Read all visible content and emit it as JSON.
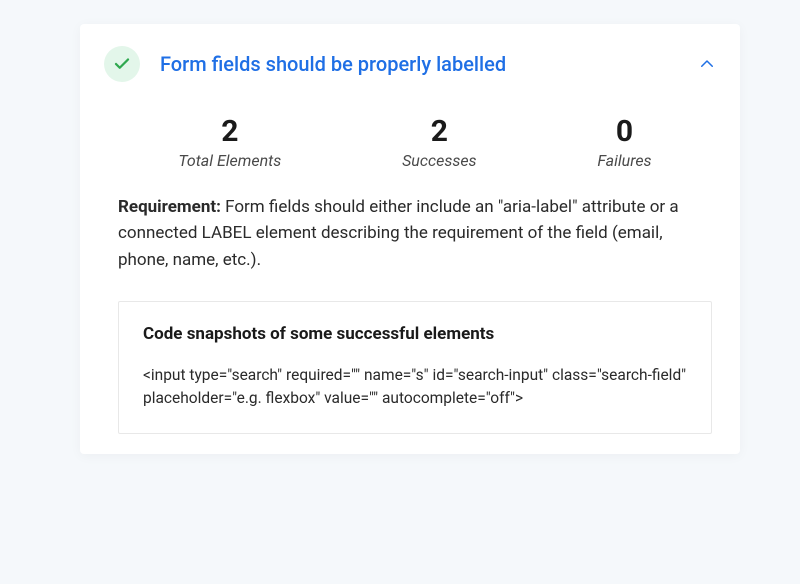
{
  "accordion": {
    "status": "success",
    "title": "Form fields should be properly labelled",
    "expanded": true
  },
  "stats": {
    "total": {
      "value": "2",
      "label": "Total Elements"
    },
    "successes": {
      "value": "2",
      "label": "Successes"
    },
    "failures": {
      "value": "0",
      "label": "Failures"
    }
  },
  "requirement": {
    "label": "Requirement:",
    "text": " Form fields should either include an \"aria-label\" attribute or a connected LABEL element describing the requirement of the field (email, phone, name, etc.)."
  },
  "snapshots": {
    "heading": "Code snapshots of some successful elements",
    "code": "<input type=\"search\" required=\"\" name=\"s\" id=\"search-input\" class=\"search-field\" placeholder=\"e.g. flexbox\" value=\"\" autocomplete=\"off\">"
  },
  "colors": {
    "accent": "#1f6fe5",
    "success_bg": "#e3f6ea",
    "success_check": "#2fa84f"
  }
}
